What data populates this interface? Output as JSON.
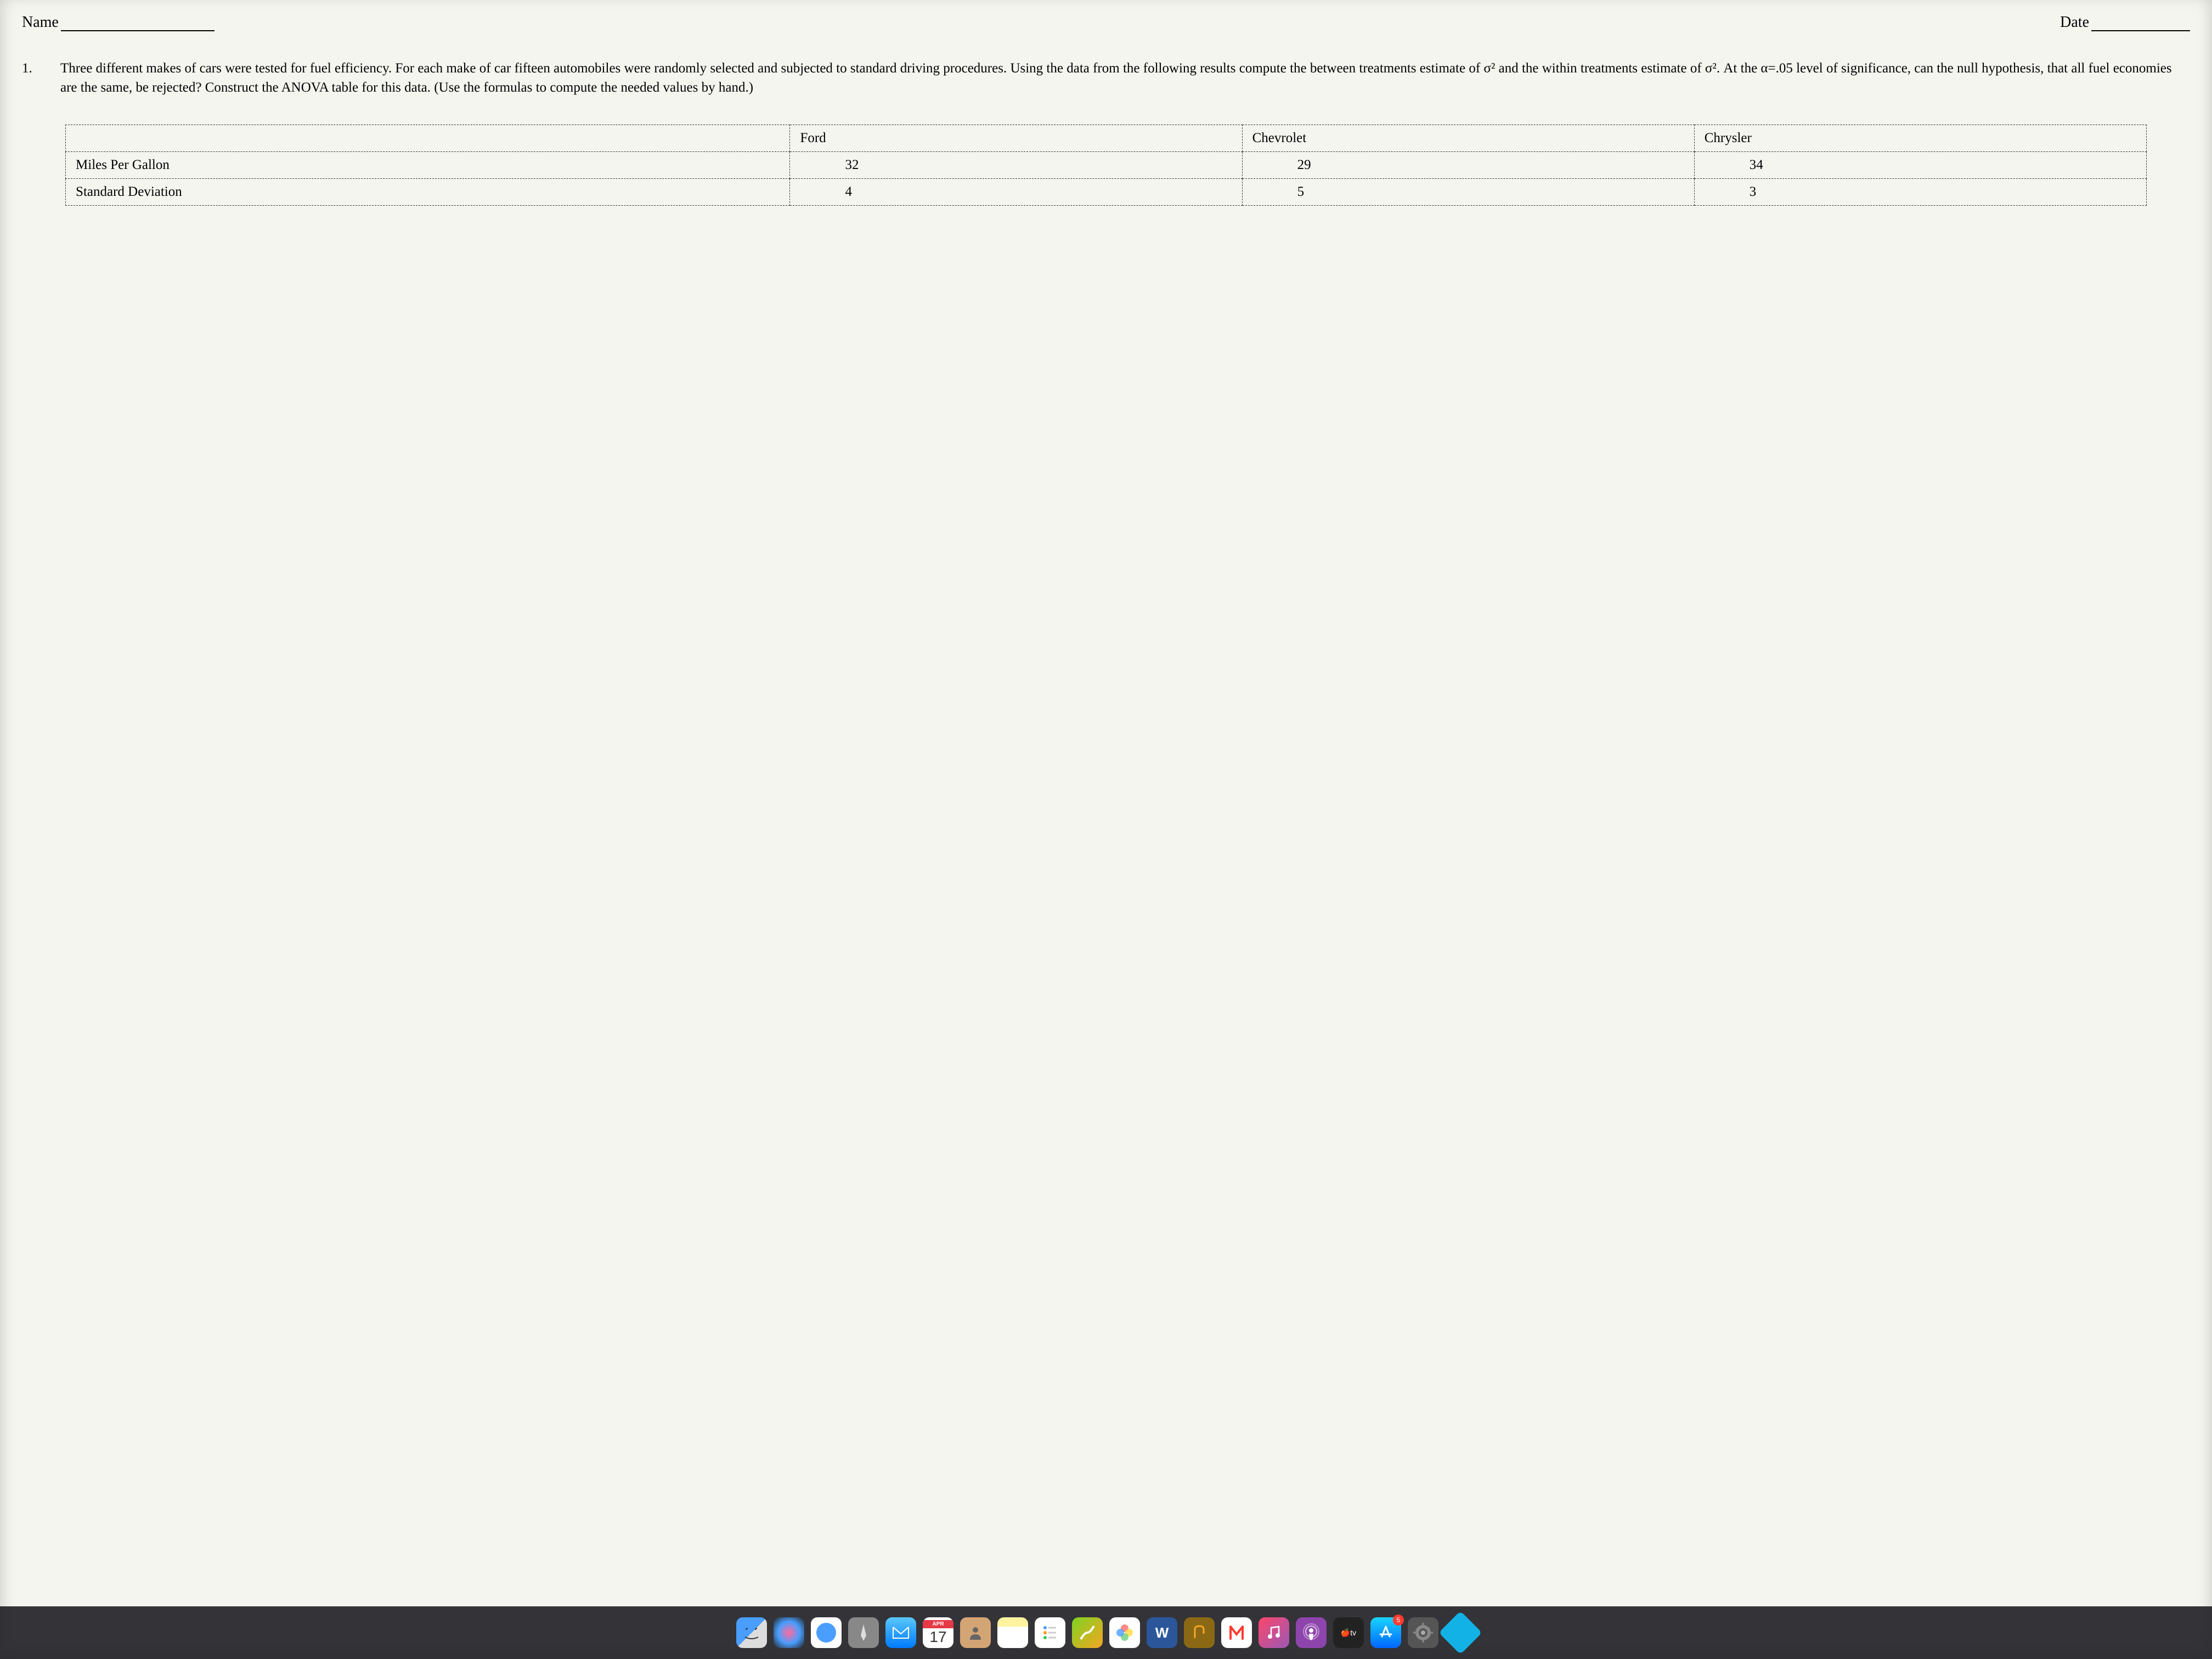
{
  "header": {
    "name_label": "Name",
    "date_label": "Date"
  },
  "question": {
    "number": "1.",
    "text": "Three different makes of cars were tested for fuel efficiency. For each make of car fifteen automobiles were randomly selected and subjected to standard driving procedures. Using the data from the following results compute the between treatments estimate of σ² and the within treatments estimate of σ². At the α=.05 level of significance, can the null hypothesis, that all fuel economies are the same, be rejected? Construct the ANOVA table for this data. (Use the formulas to compute the needed values by hand.)"
  },
  "chart_data": {
    "type": "table",
    "columns": [
      "",
      "Ford",
      "Chevrolet",
      "Chrysler"
    ],
    "rows": [
      {
        "label": "Miles Per Gallon",
        "values": [
          32,
          29,
          34
        ]
      },
      {
        "label": "Standard Deviation",
        "values": [
          4,
          5,
          3
        ]
      }
    ]
  },
  "dock": {
    "calendar": {
      "month": "APR",
      "day": "17"
    },
    "word_letter": "W",
    "appletv_label": "🍎tv",
    "appstore_badge": "5",
    "icons": {
      "finder": "finder",
      "siri": "siri",
      "safari": "safari",
      "launchpad": "launchpad",
      "mail": "mail",
      "calendar": "calendar",
      "contacts": "contacts",
      "notes": "notes",
      "reminders": "reminders",
      "maps": "maps",
      "photos": "photos",
      "word": "word",
      "garageband": "garageband",
      "news": "news",
      "music": "music",
      "podcasts": "podcasts",
      "appletv": "appletv",
      "appstore": "appstore",
      "settings": "settings",
      "kodi": "kodi"
    }
  }
}
